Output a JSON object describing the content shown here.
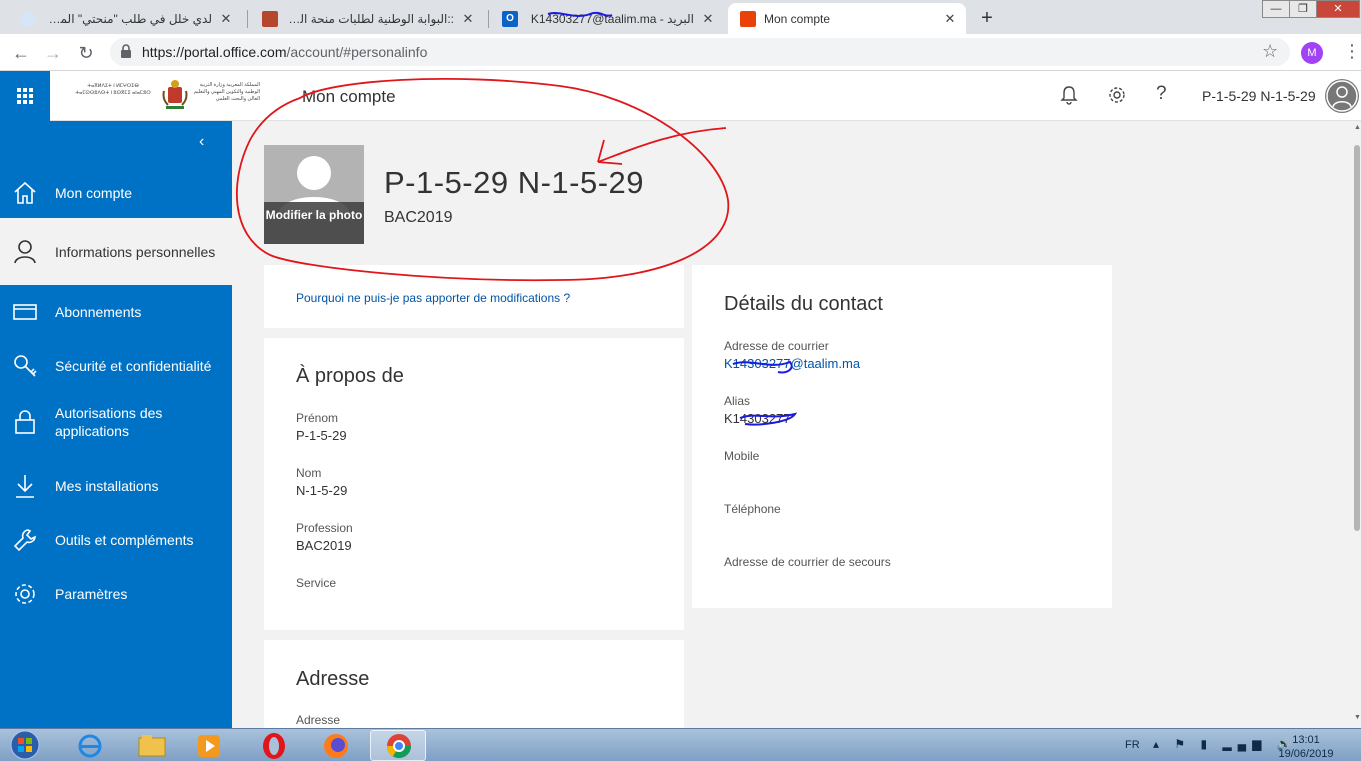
{
  "browser": {
    "tabs": [
      {
        "title": "لدي خلل في طلب \"منحتي\" المرجو مساعدتي",
        "icon_color": "#4a90d9"
      },
      {
        "title": "::البوابة الوطنية لطلبات منحة التعليم العالي",
        "icon_color": "#b5472f"
      },
      {
        "title": "البريد - K14303277@taalim.ma",
        "icon_color": "#0a64c8"
      },
      {
        "title": "Mon compte",
        "icon_color": "#e8410a"
      }
    ],
    "url_host": "https://portal.office.com",
    "url_path": "/account/#personalinfo",
    "profile_initial": "M"
  },
  "header": {
    "title": "Mon compte",
    "user": "P-1-5-29 N-1-5-29",
    "logo_left_text": "ⵜⴰⴳⵍⴷⵉⵜ ⵏ ⵍⵎⵖⵔⵉⴱ ⵜⴰⵎⵙⵙⵓⴷⵙⵜ ⵏ ⵓⵙⴳⵎⵉ ⴰⵏⴰⵎⵓⵔ",
    "logo_right_text": "المملكة المغربية وزارة التربية الوطنية والتكوين المهني والتعليم العالي والبحث العلمي"
  },
  "nav": {
    "items": [
      {
        "label": "Mon compte",
        "icon": "home-icon"
      },
      {
        "label": "Informations personnelles",
        "icon": "person-icon"
      },
      {
        "label": "Abonnements",
        "icon": "card-icon"
      },
      {
        "label": "Sécurité et confidentialité",
        "icon": "key-search-icon"
      },
      {
        "label": "Autorisations des applications",
        "icon": "lock-icon"
      },
      {
        "label": "Mes installations",
        "icon": "download-icon"
      },
      {
        "label": "Outils et compléments",
        "icon": "wrench-icon"
      },
      {
        "label": "Paramètres",
        "icon": "gear-icon"
      }
    ],
    "selected_index": 1
  },
  "profile": {
    "photo_label": "Modifier la photo",
    "display_name": "P-1-5-29 N-1-5-29",
    "subtitle": "BAC2019"
  },
  "info_card": {
    "link": "Pourquoi ne puis-je pas apporter de modifications ?"
  },
  "about": {
    "title": "À propos de",
    "fields": [
      {
        "label": "Prénom",
        "value": "P-1-5-29"
      },
      {
        "label": "Nom",
        "value": "N-1-5-29"
      },
      {
        "label": "Profession",
        "value": "BAC2019"
      },
      {
        "label": "Service",
        "value": ""
      }
    ]
  },
  "address": {
    "title": "Adresse",
    "fields": [
      {
        "label": "Adresse",
        "value": ""
      }
    ]
  },
  "contact": {
    "title": "Détails du contact",
    "fields": [
      {
        "label": "Adresse de courrier",
        "value": "K14303277@taalim.ma"
      },
      {
        "label": "Alias",
        "value": "K14303277"
      },
      {
        "label": "Mobile",
        "value": ""
      },
      {
        "label": "Téléphone",
        "value": ""
      },
      {
        "label": "Adresse de courrier de secours",
        "value": ""
      }
    ]
  },
  "taskbar": {
    "language": "FR",
    "time": "13:01",
    "date": "19/06/2019"
  },
  "colors": {
    "office_blue": "#0072c6",
    "link_blue": "#0055a8",
    "annotation_red": "#e0161b",
    "scribble_blue": "#1a1ae0"
  }
}
